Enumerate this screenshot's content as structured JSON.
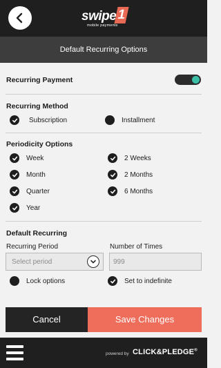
{
  "header": {
    "logo_text": "swiper",
    "logo_number": "1",
    "logo_subtitle": "mobile payments",
    "back_icon": "chevron-left-icon"
  },
  "title": "Default Recurring Options",
  "recurring_payment": {
    "label": "Recurring Payment",
    "enabled": true,
    "toggle_color": "#3bbfa6"
  },
  "recurring_method": {
    "title": "Recurring Method",
    "options": [
      {
        "label": "Subscription",
        "checked": true
      },
      {
        "label": "Installment",
        "checked": false
      }
    ]
  },
  "periodicity": {
    "title": "Periodicity Options",
    "options": [
      {
        "label": "Week",
        "checked": true
      },
      {
        "label": "2 Weeks",
        "checked": true
      },
      {
        "label": "Month",
        "checked": true
      },
      {
        "label": "2 Months",
        "checked": true
      },
      {
        "label": "Quarter",
        "checked": true
      },
      {
        "label": "6 Months",
        "checked": true
      },
      {
        "label": "Year",
        "checked": true
      }
    ]
  },
  "default_recurring": {
    "title": "Default Recurring",
    "period_label": "Recurring Period",
    "period_placeholder": "Select period",
    "times_label": "Number of Times",
    "times_placeholder": "999",
    "lock_label": "Lock options",
    "lock_checked": false,
    "indefinite_label": "Set to indefinite",
    "indefinite_checked": true
  },
  "actions": {
    "cancel": "Cancel",
    "save": "Save Changes",
    "save_color": "#ee6d5b"
  },
  "footer": {
    "menu_icon": "hamburger-menu-icon",
    "powered_by": "powered by",
    "brand": "CLICK&PLEDGE",
    "brand_mark": "®"
  }
}
